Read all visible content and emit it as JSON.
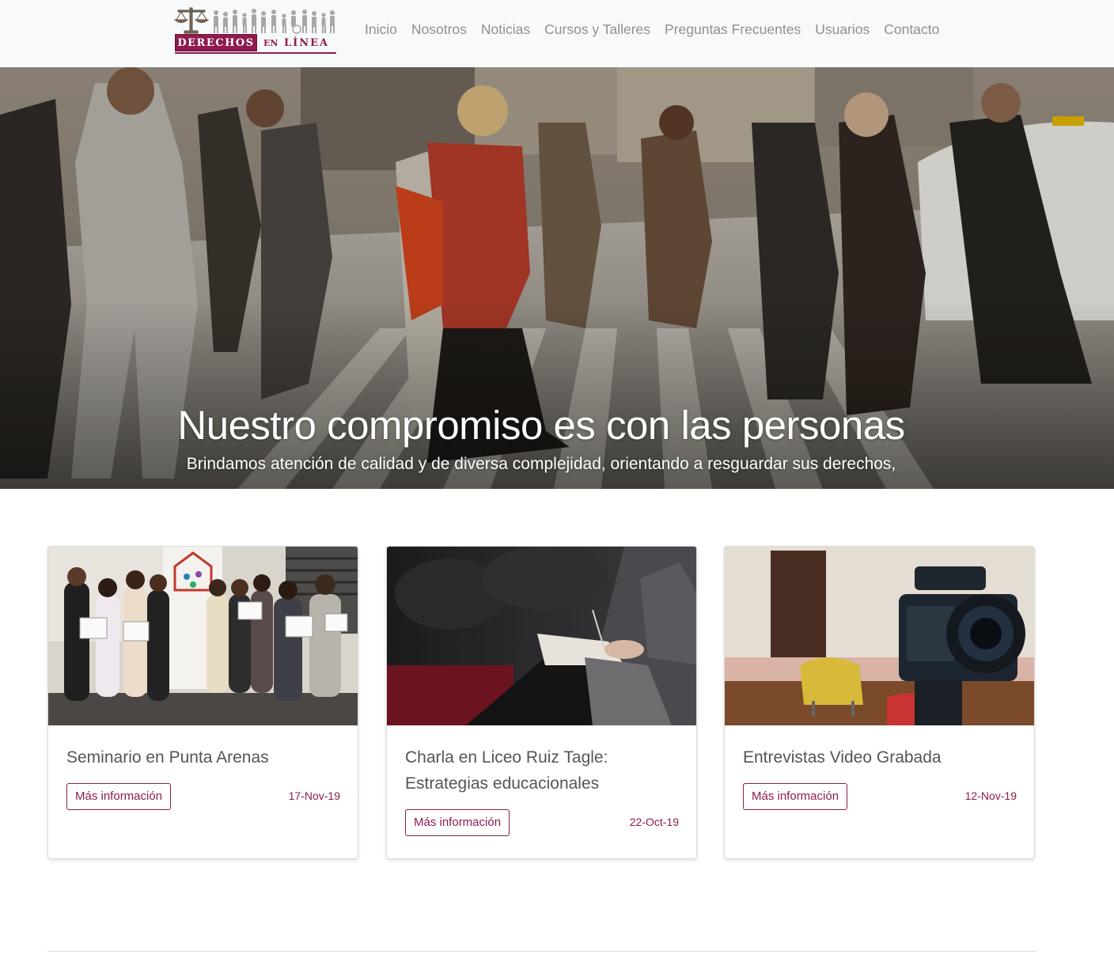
{
  "brand": {
    "word1": "DERECHOS",
    "word2": "EN",
    "word3": "LÍNEA",
    "brand_color": "#8e1b4e"
  },
  "nav": {
    "items": [
      {
        "label": "Inicio"
      },
      {
        "label": "Nosotros"
      },
      {
        "label": "Noticias"
      },
      {
        "label": "Cursos y Talleres"
      },
      {
        "label": "Preguntas Frecuentes"
      },
      {
        "label": "Usuarios"
      },
      {
        "label": "Contacto"
      }
    ]
  },
  "hero": {
    "title": "Nuestro compromiso es con las personas",
    "subtitle": "Brindamos atención de calidad y de diversa complejidad, orientando a resguardar sus derechos,",
    "slide_count": 3,
    "active_slide": 2
  },
  "cards": [
    {
      "title": "Seminario en Punta Arenas",
      "button": "Más información",
      "date": "17-Nov-19"
    },
    {
      "title": "Charla en Liceo Ruiz Tagle: Estrategias educacionales",
      "button": "Más información",
      "date": "22-Oct-19"
    },
    {
      "title": "Entrevistas Video Grabada",
      "button": "Más información",
      "date": "12-Nov-19"
    }
  ]
}
